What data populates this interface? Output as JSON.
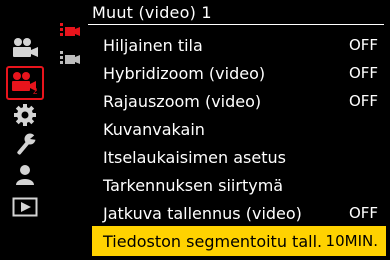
{
  "menu": {
    "title": "Muut (video) 1",
    "main_tabs": [
      {
        "name": "video-camera-tab-1",
        "icon": "video-camera-icon",
        "active": false
      },
      {
        "name": "video-camera-tab-2",
        "icon": "video-camera-2-icon",
        "badge": "2",
        "active": true
      },
      {
        "name": "gear-tab",
        "icon": "gear-icon",
        "active": false
      },
      {
        "name": "wrench-tab",
        "icon": "wrench-icon",
        "active": false
      },
      {
        "name": "person-tab",
        "icon": "person-icon",
        "active": false
      },
      {
        "name": "playback-tab",
        "icon": "playback-icon",
        "active": false
      }
    ],
    "sub_tabs": [
      {
        "name": "subtab-1",
        "icon": "video-camera-small-icon",
        "active": true
      },
      {
        "name": "subtab-2",
        "icon": "video-camera-small-icon",
        "active": false
      }
    ],
    "items": [
      {
        "label": "Hiljainen tila",
        "value": "OFF"
      },
      {
        "label": "Hybridizoom (video)",
        "value": "OFF"
      },
      {
        "label": "Rajauszoom (video)",
        "value": "OFF"
      },
      {
        "label": "Kuvanvakain",
        "value": ""
      },
      {
        "label": "Itselaukaisimen asetus",
        "value": ""
      },
      {
        "label": "Tarkennuksen siirtymä",
        "value": ""
      },
      {
        "label": "Jatkuva tallennus (video)",
        "value": "OFF"
      },
      {
        "label": "Tiedoston segmentoitu tall.",
        "value": "10MIN.",
        "selected": true
      }
    ]
  },
  "colors": {
    "background": "#000000",
    "accent_red": "#e8141c",
    "selection_yellow": "#ffd200",
    "icon_gray": "#d4d4d4"
  }
}
